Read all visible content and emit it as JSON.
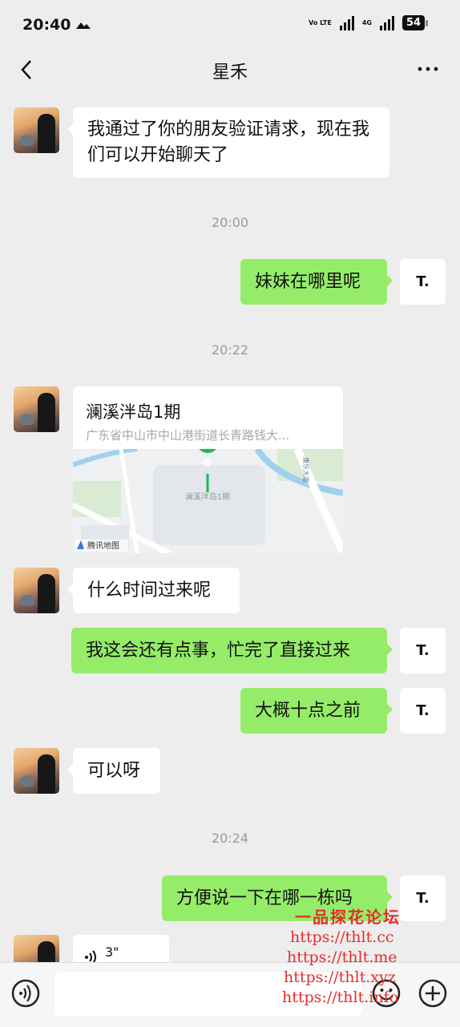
{
  "status_bar": {
    "time": "20:40",
    "network_1": "Vo LTE",
    "network_2": "4G",
    "battery": "54"
  },
  "nav": {
    "title": "星禾"
  },
  "messages": {
    "m1": "我通过了你的朋友验证请求，现在我们可以开始聊天了",
    "t1": "20:00",
    "m2": "妹妹在哪里呢",
    "t2": "20:22",
    "location": {
      "name": "澜溪泮岛1期",
      "address": "广东省中山市中山港街道长青路钱大...",
      "map_label": "澜溪泮岛1期",
      "road_label": "康乐大道",
      "provider": "腾讯地图"
    },
    "m3": "什么时间过来呢",
    "m4": "我这会还有点事，忙完了直接过来",
    "m5": "大概十点之前",
    "m6": "可以呀",
    "t3": "20:24",
    "m7": "方便说一下在哪一栋吗",
    "m8": "3\""
  },
  "self_avatar": "T.",
  "watermark": {
    "title": "一品探花论坛",
    "urls": [
      "https://thlt.cc",
      "https://thlt.me",
      "https://thlt.xyz",
      "https://thlt.info"
    ]
  },
  "colors": {
    "out_bubble": "#95ec69",
    "in_bubble": "#ffffff",
    "background": "#ededed",
    "watermark": "#e62d2d"
  }
}
